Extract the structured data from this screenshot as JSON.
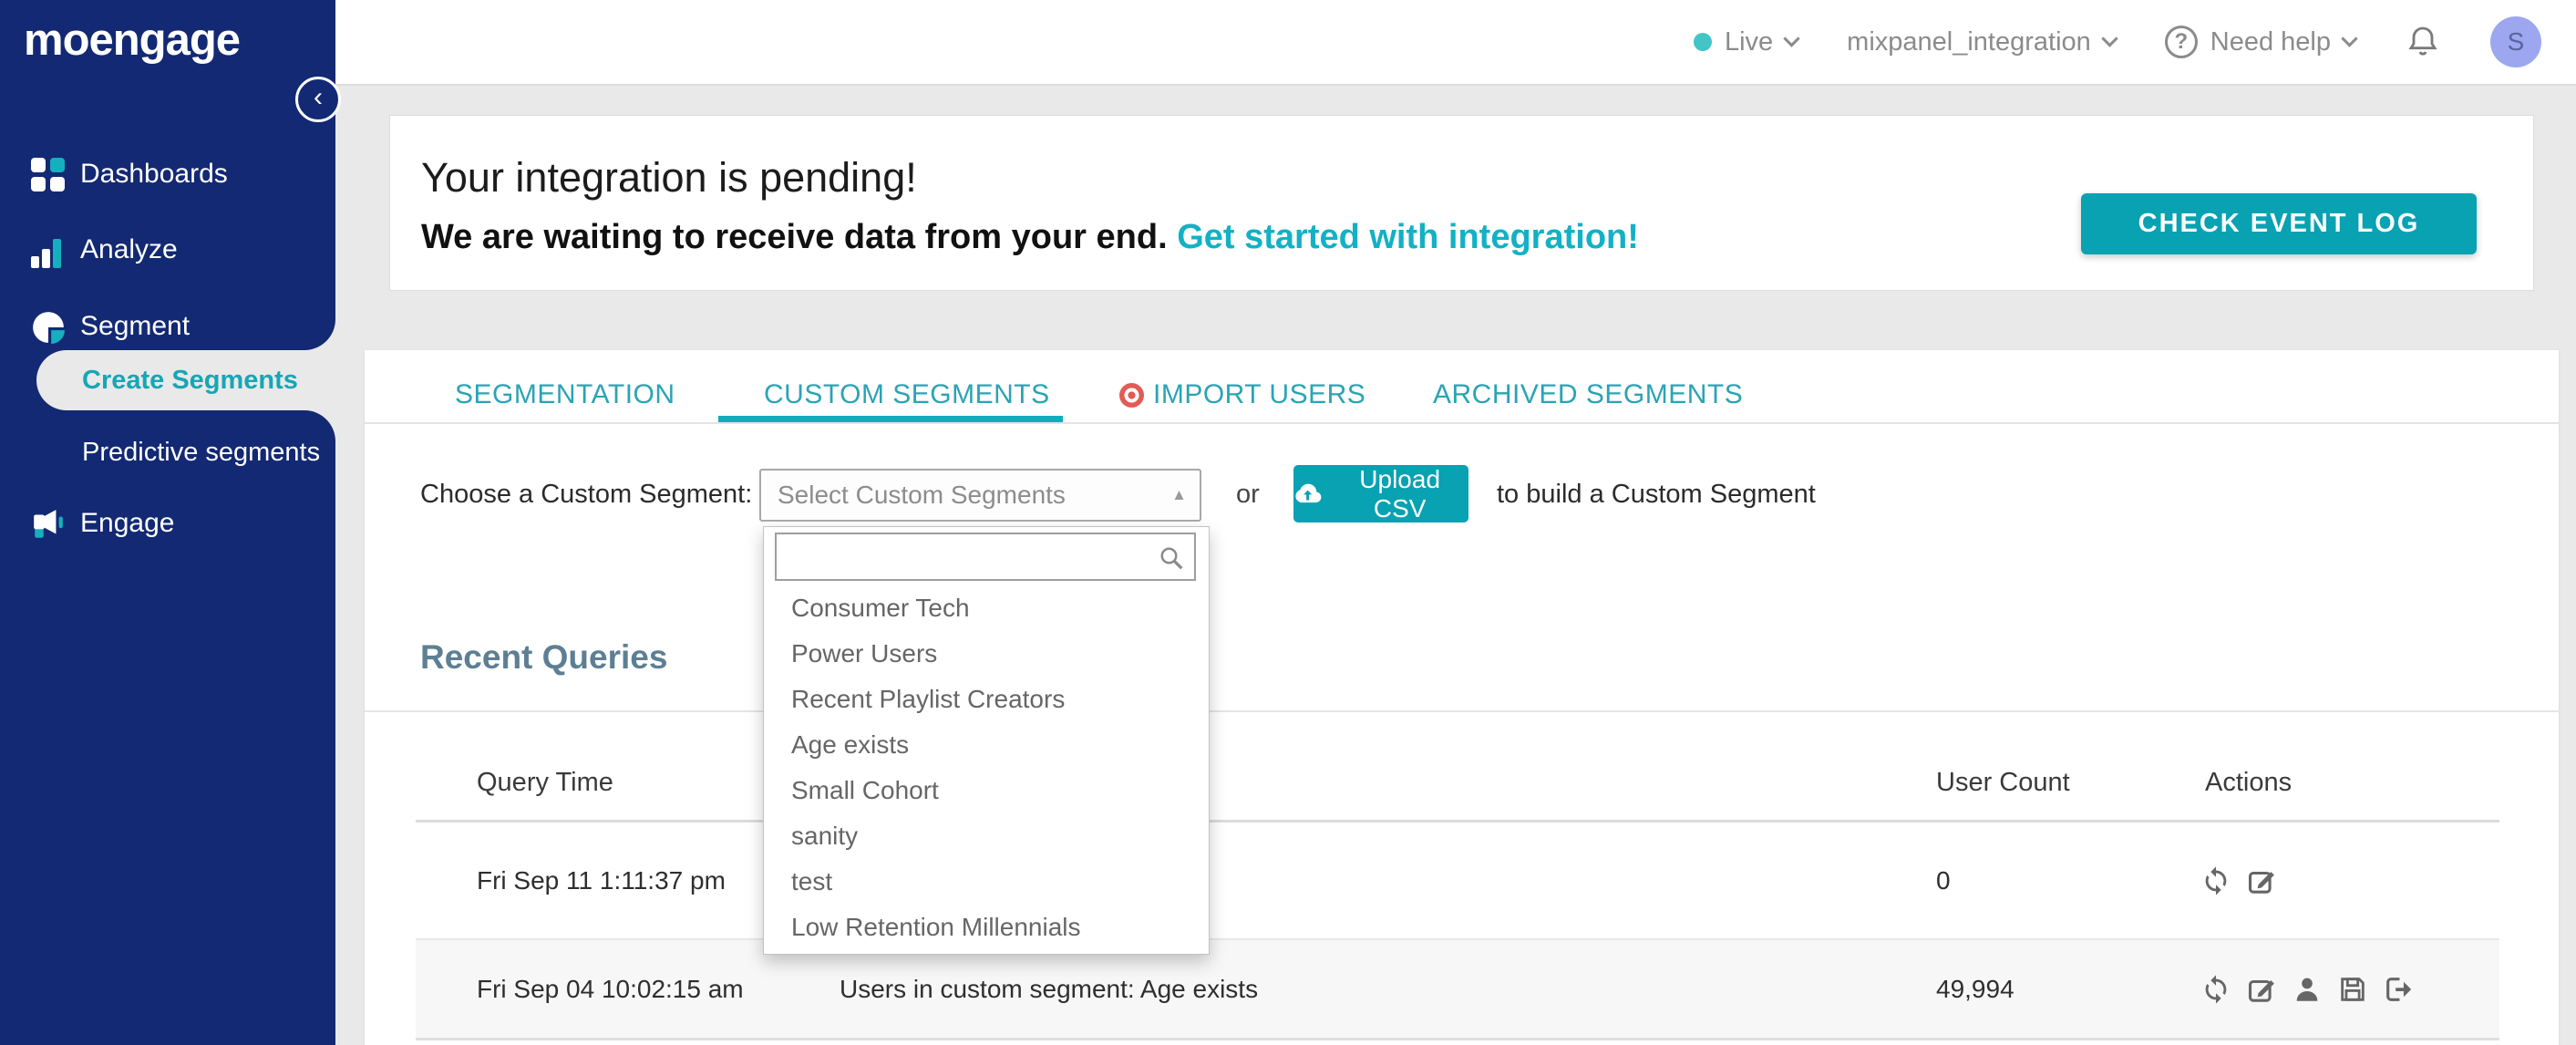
{
  "sidebar": {
    "logo_text": "moengage",
    "items": [
      {
        "label": "Dashboards",
        "icon": "dashboard-grid-icon"
      },
      {
        "label": "Analyze",
        "icon": "bar-chart-icon"
      },
      {
        "label": "Segment",
        "icon": "pie-chart-icon"
      },
      {
        "label": "Engage",
        "icon": "megaphone-icon"
      }
    ],
    "segment_subitems": [
      {
        "label": "Create Segments",
        "active": true
      },
      {
        "label": "Predictive segments",
        "active": false
      }
    ]
  },
  "topbar": {
    "environment": "Live",
    "workspace": "mixpanel_integration",
    "help": "Need help",
    "avatar_initial": "S"
  },
  "banner": {
    "title": "Your integration is pending!",
    "subtitle": "We are waiting to receive data from your end.",
    "link_text": "Get started with integration!",
    "button_label": "CHECK EVENT LOG"
  },
  "tabs": [
    {
      "label": "SEGMENTATION",
      "active": false
    },
    {
      "label": "CUSTOM SEGMENTS",
      "active": true
    },
    {
      "label": "IMPORT USERS",
      "active": false,
      "badge": "red-dot"
    },
    {
      "label": "ARCHIVED SEGMENTS",
      "active": false
    }
  ],
  "segment_picker": {
    "label": "Choose a Custom Segment:",
    "select_value": "Select Custom Segments",
    "or_text": "or",
    "upload_button_label": "Upload CSV",
    "suffix_text": "to build a Custom Segment",
    "search_value": "",
    "options": [
      "Consumer Tech",
      "Power Users",
      "Recent Playlist Creators",
      "Age exists",
      "Small Cohort",
      "sanity",
      "test",
      "Low Retention Millennials"
    ]
  },
  "recent_queries": {
    "title": "Recent Queries",
    "columns": [
      "Query Time",
      "User Count",
      "Actions"
    ],
    "rows": [
      {
        "query_time": "Fri Sep 11 1:11:37 pm",
        "query": "",
        "user_count": "0",
        "actions": [
          "refresh",
          "edit"
        ]
      },
      {
        "query_time": "Fri Sep 04 10:02:15 am",
        "query": "Users in custom segment: Age exists",
        "user_count": "49,994",
        "actions": [
          "refresh",
          "edit",
          "user",
          "save",
          "export"
        ]
      }
    ]
  },
  "icons": {
    "select_caret": "▲",
    "collapse_chevron": "‹",
    "help_glyph": "?"
  },
  "colors": {
    "sidebar_navy": "#132973",
    "accent_teal": "#08a2b2",
    "tab_teal": "#2aa4b4",
    "link_teal": "#12b1c5",
    "heading_slate": "#5d7f94",
    "alert_red": "#e25c55",
    "avatar_bg": "#9ca7f0",
    "background_gray": "#e9e9e9"
  }
}
